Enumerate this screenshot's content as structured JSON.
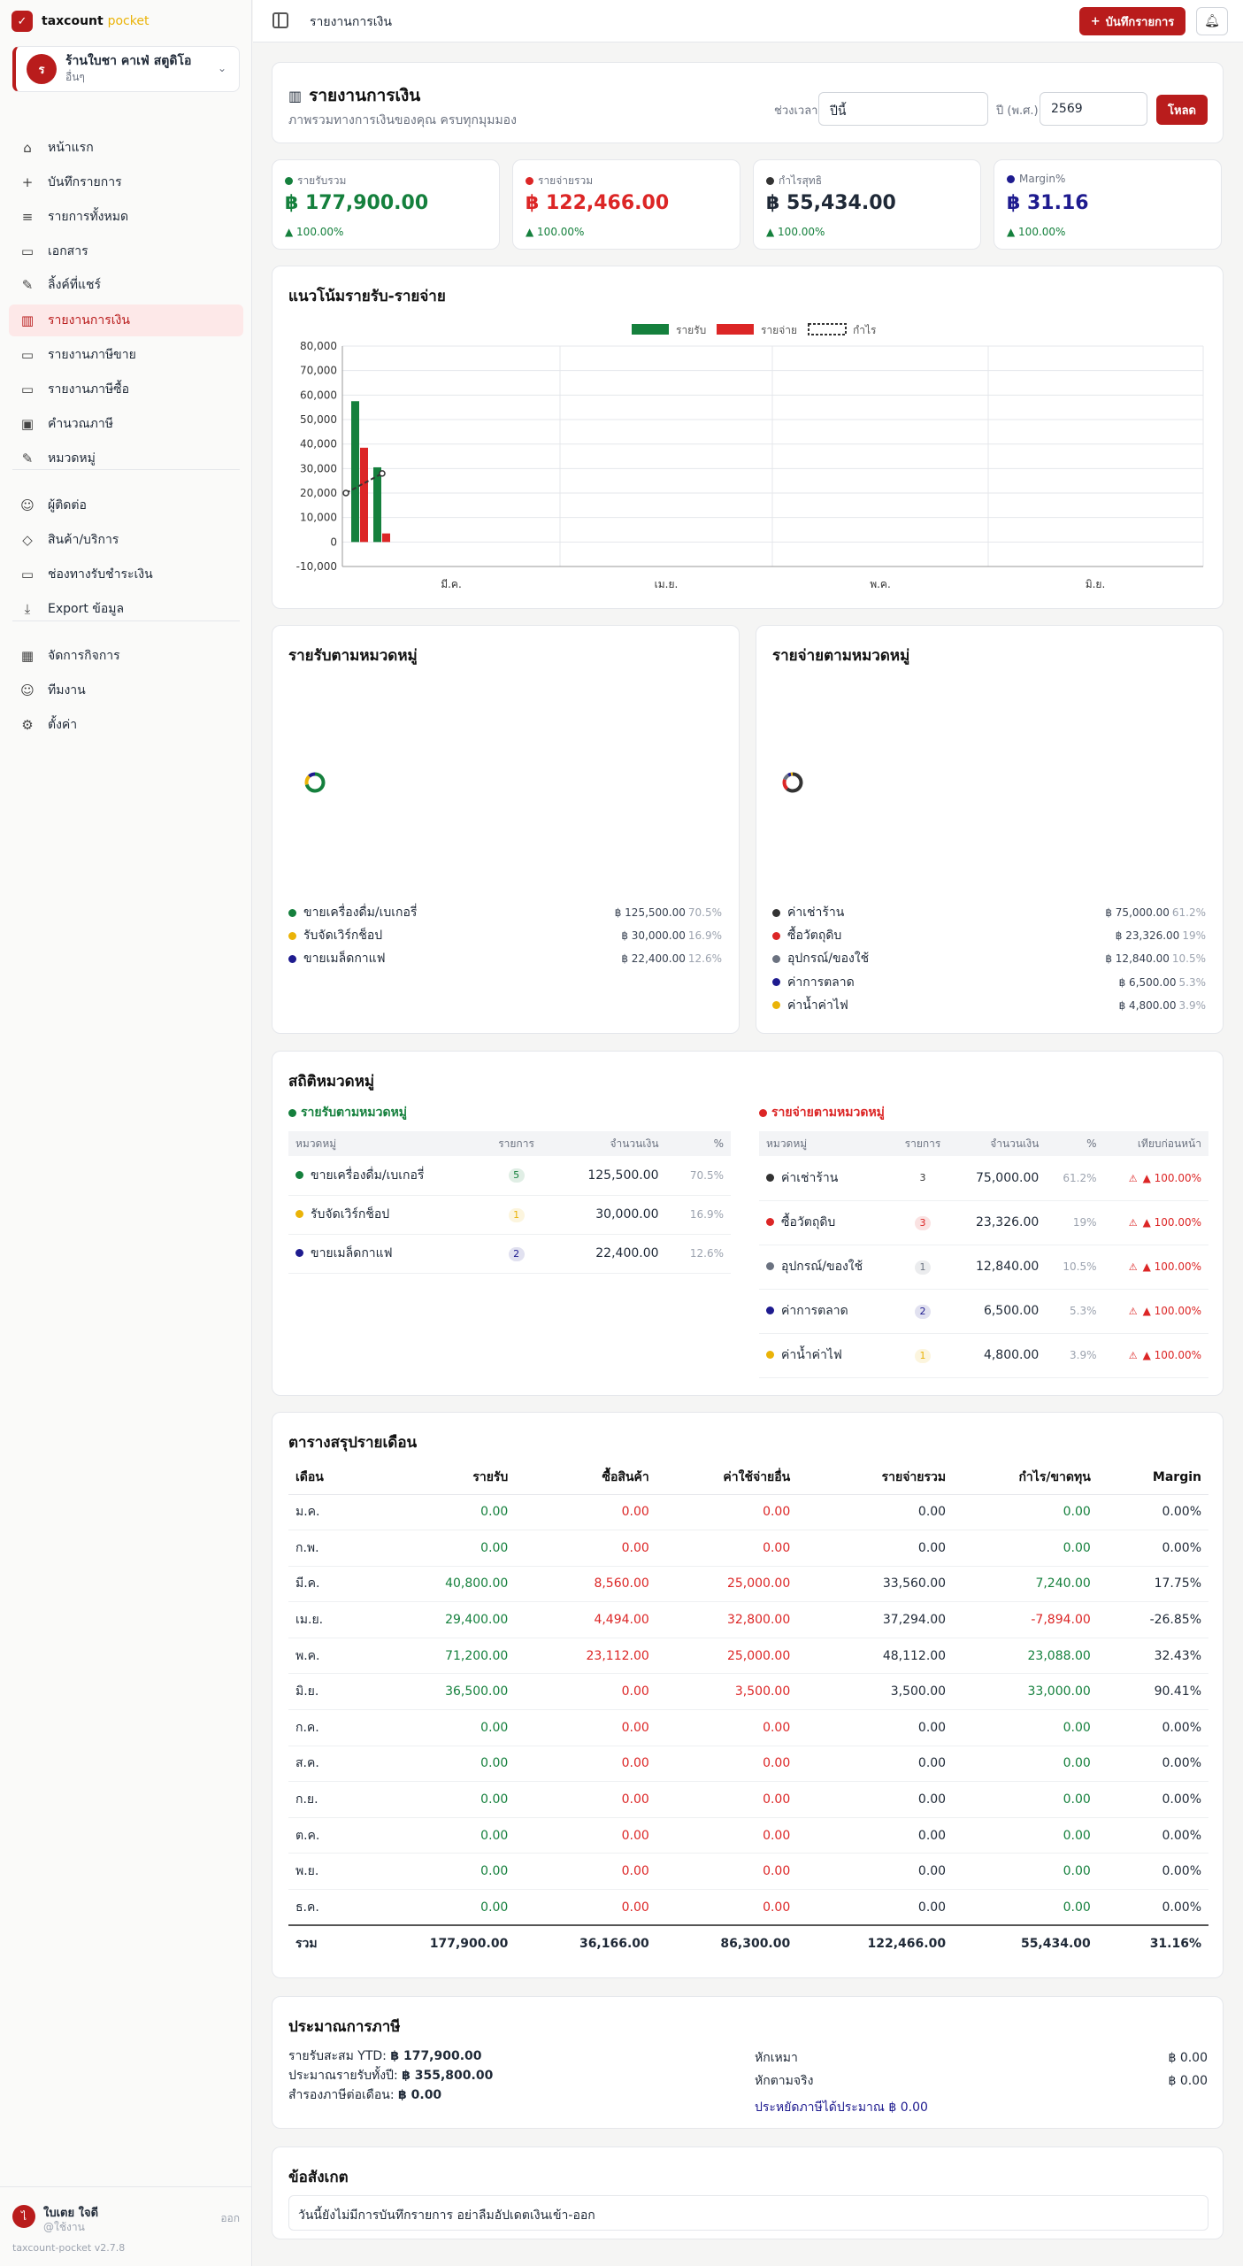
{
  "brand": {
    "name": "taxcount",
    "suffix": "pocket"
  },
  "workspace": {
    "initial": "ร",
    "name": "ร้านใบชา คาเฟ่ สตูดิโอ",
    "type": "อื่นๆ"
  },
  "nav": [
    {
      "label": "หน้าแรก",
      "icon": "home-icon",
      "glyph": "⌂"
    },
    {
      "label": "บันทึกรายการ",
      "icon": "plus-icon",
      "glyph": "+"
    },
    {
      "label": "รายการทั้งหมด",
      "icon": "list-icon",
      "glyph": "≡"
    },
    {
      "label": "เอกสาร",
      "icon": "document-icon",
      "glyph": "▭"
    },
    {
      "label": "ลิ้งค์ที่แชร์",
      "icon": "pencil-icon",
      "glyph": "✎"
    },
    {
      "label": "รายงานการเงิน",
      "icon": "bar-chart-icon",
      "glyph": "▥"
    },
    {
      "label": "รายงานภาษีขาย",
      "icon": "document-icon",
      "glyph": "▭"
    },
    {
      "label": "รายงานภาษีซื้อ",
      "icon": "document-icon",
      "glyph": "▭"
    },
    {
      "label": "คำนวณภาษี",
      "icon": "calculator-icon",
      "glyph": "▣"
    },
    {
      "label": "หมวดหมู่",
      "icon": "tag-icon",
      "glyph": "✎"
    },
    {
      "label": "ผู้ติดต่อ",
      "icon": "user-icon",
      "glyph": "☺"
    },
    {
      "label": "สินค้า/บริการ",
      "icon": "package-icon",
      "glyph": "◇"
    },
    {
      "label": "ช่องทางรับชำระเงิน",
      "icon": "credit-card-icon",
      "glyph": "▭"
    },
    {
      "label": "Export ข้อมูล",
      "icon": "download-icon",
      "glyph": "⤓"
    },
    {
      "label": "จัดการกิจการ",
      "icon": "building-icon",
      "glyph": "▦"
    },
    {
      "label": "ทีมงาน",
      "icon": "team-icon",
      "glyph": "☺"
    },
    {
      "label": "ตั้งค่า",
      "icon": "gear-icon",
      "glyph": "⚙"
    }
  ],
  "user": {
    "initial": "ไ",
    "name": "ใบเตย ใจดี",
    "role": "@ใช้งาน",
    "logout": "ออก",
    "version": "taxcount-pocket v2.7.8"
  },
  "topbar": {
    "title": "รายงานการเงิน",
    "add_label": "บันทึกรายการ"
  },
  "header": {
    "title": "รายงานการเงิน",
    "subtitle": "ภาพรวมทางการเงินของคุณ ครบทุกมุมมอง",
    "period_label": "ช่วงเวลา",
    "period_value": "ปีนี้",
    "year_label": "ปี (พ.ศ.)",
    "year_value": "2569",
    "load_label": "โหลด"
  },
  "kpis": [
    {
      "label": "รายรับรวม",
      "value": "฿ 177,900.00",
      "change": "▲ 100.00%",
      "color": "#15803d",
      "dot": "#15803d"
    },
    {
      "label": "รายจ่ายรวม",
      "value": "฿ 122,466.00",
      "change": "▲ 100.00%",
      "color": "#dc2626",
      "dot": "#dc2626"
    },
    {
      "label": "กำไรสุทธิ",
      "value": "฿ 55,434.00",
      "change": "▲ 100.00%",
      "color": "#1f2937",
      "dot": "#333"
    },
    {
      "label": "Margin%",
      "value": "฿ 31.16",
      "change": "▲ 100.00%",
      "color": "#1e1b8f",
      "dot": "#1e1b8f"
    }
  ],
  "chart_data": {
    "type": "bar",
    "title": "แนวโน้มรายรับ-รายจ่าย",
    "legend": [
      "รายรับ",
      "รายจ่าย",
      "กำไร"
    ],
    "x_labels": [
      "มี.ค.",
      "เม.ย.",
      "พ.ค.",
      "มิ.ย."
    ],
    "ylim": [
      -10000,
      80000
    ],
    "yticks": [
      "80,000",
      "70,000",
      "60,000",
      "50,000",
      "40,000",
      "30,000",
      "20,000",
      "10,000",
      "0",
      "-10,000"
    ],
    "series": [
      {
        "name": "รายรับ",
        "color": "#15803d",
        "values": [
          57500,
          30500
        ]
      },
      {
        "name": "รายจ่าย",
        "color": "#dc2626",
        "values": [
          38500,
          3500
        ]
      }
    ],
    "profit_points": [
      20000,
      28000
    ]
  },
  "income_cat": {
    "title": "รายรับตามหมวดหมู่",
    "items": [
      {
        "name": "ขายเครื่องดื่ม/เบเกอรี่",
        "amount": "฿ 125,500.00",
        "pct": "70.5%",
        "color": "#15803d"
      },
      {
        "name": "รับจัดเวิร์กช็อป",
        "amount": "฿ 30,000.00",
        "pct": "16.9%",
        "color": "#eab308"
      },
      {
        "name": "ขายเมล็ดกาแฟ",
        "amount": "฿ 22,400.00",
        "pct": "12.6%",
        "color": "#1e1b8f"
      }
    ]
  },
  "expense_cat": {
    "title": "รายจ่ายตามหมวดหมู่",
    "items": [
      {
        "name": "ค่าเช่าร้าน",
        "amount": "฿ 75,000.00",
        "pct": "61.2%",
        "color": "#333"
      },
      {
        "name": "ซื้อวัตถุดิบ",
        "amount": "฿ 23,326.00",
        "pct": "19%",
        "color": "#dc2626"
      },
      {
        "name": "อุปกรณ์/ของใช้",
        "amount": "฿ 12,840.00",
        "pct": "10.5%",
        "color": "#6b7280"
      },
      {
        "name": "ค่าการตลาด",
        "amount": "฿ 6,500.00",
        "pct": "5.3%",
        "color": "#1e1b8f"
      },
      {
        "name": "ค่าน้ำค่าไฟ",
        "amount": "฿ 4,800.00",
        "pct": "3.9%",
        "color": "#eab308"
      }
    ]
  },
  "stats": {
    "title": "สถิติหมวดหมู่",
    "income_title": "รายรับตามหมวดหมู่",
    "expense_title": "รายจ่ายตามหมวดหมู่",
    "income_cols": [
      "หมวดหมู่",
      "รายการ",
      "จำนวนเงิน",
      "%"
    ],
    "expense_cols": [
      "หมวดหมู่",
      "รายการ",
      "จำนวนเงิน",
      "%",
      "เทียบก่อนหน้า"
    ],
    "income_rows": [
      {
        "name": "ขายเครื่องดื่ม/เบเกอรี่",
        "count": "5",
        "amount": "125,500.00",
        "pct": "70.5%",
        "color": "#15803d"
      },
      {
        "name": "รับจัดเวิร์กช็อป",
        "count": "1",
        "amount": "30,000.00",
        "pct": "16.9%",
        "color": "#eab308"
      },
      {
        "name": "ขายเมล็ดกาแฟ",
        "count": "2",
        "amount": "22,400.00",
        "pct": "12.6%",
        "color": "#1e1b8f"
      }
    ],
    "expense_rows": [
      {
        "name": "ค่าเช่าร้าน",
        "count": "3",
        "amount": "75,000.00",
        "pct": "61.2%",
        "change": "▲ 100.00%",
        "color": "#333"
      },
      {
        "name": "ซื้อวัตถุดิบ",
        "count": "3",
        "amount": "23,326.00",
        "pct": "19%",
        "change": "▲ 100.00%",
        "color": "#dc2626"
      },
      {
        "name": "อุปกรณ์/ของใช้",
        "count": "1",
        "amount": "12,840.00",
        "pct": "10.5%",
        "change": "▲ 100.00%",
        "color": "#6b7280"
      },
      {
        "name": "ค่าการตลาด",
        "count": "2",
        "amount": "6,500.00",
        "pct": "5.3%",
        "change": "▲ 100.00%",
        "color": "#1e1b8f"
      },
      {
        "name": "ค่าน้ำค่าไฟ",
        "count": "1",
        "amount": "4,800.00",
        "pct": "3.9%",
        "change": "▲ 100.00%",
        "color": "#eab308"
      }
    ]
  },
  "monthly": {
    "title": "ตารางสรุปรายเดือน",
    "cols": [
      "เดือน",
      "รายรับ",
      "ซื้อสินค้า",
      "ค่าใช้จ่ายอื่น",
      "รายจ่ายรวม",
      "กำไร/ขาดทุน",
      "Margin"
    ],
    "rows": [
      [
        "ม.ค.",
        "0.00",
        "0.00",
        "0.00",
        "0.00",
        "0.00",
        "0.00%"
      ],
      [
        "ก.พ.",
        "0.00",
        "0.00",
        "0.00",
        "0.00",
        "0.00",
        "0.00%"
      ],
      [
        "มี.ค.",
        "40,800.00",
        "8,560.00",
        "25,000.00",
        "33,560.00",
        "7,240.00",
        "17.75%"
      ],
      [
        "เม.ย.",
        "29,400.00",
        "4,494.00",
        "32,800.00",
        "37,294.00",
        "-7,894.00",
        "-26.85%"
      ],
      [
        "พ.ค.",
        "71,200.00",
        "23,112.00",
        "25,000.00",
        "48,112.00",
        "23,088.00",
        "32.43%"
      ],
      [
        "มิ.ย.",
        "36,500.00",
        "0.00",
        "3,500.00",
        "3,500.00",
        "33,000.00",
        "90.41%"
      ],
      [
        "ก.ค.",
        "0.00",
        "0.00",
        "0.00",
        "0.00",
        "0.00",
        "0.00%"
      ],
      [
        "ส.ค.",
        "0.00",
        "0.00",
        "0.00",
        "0.00",
        "0.00",
        "0.00%"
      ],
      [
        "ก.ย.",
        "0.00",
        "0.00",
        "0.00",
        "0.00",
        "0.00",
        "0.00%"
      ],
      [
        "ต.ค.",
        "0.00",
        "0.00",
        "0.00",
        "0.00",
        "0.00",
        "0.00%"
      ],
      [
        "พ.ย.",
        "0.00",
        "0.00",
        "0.00",
        "0.00",
        "0.00",
        "0.00%"
      ],
      [
        "ธ.ค.",
        "0.00",
        "0.00",
        "0.00",
        "0.00",
        "0.00",
        "0.00%"
      ]
    ],
    "total": [
      "รวม",
      "177,900.00",
      "36,166.00",
      "86,300.00",
      "122,466.00",
      "55,434.00",
      "31.16%"
    ]
  },
  "tax": {
    "title": "ประมาณการภาษี",
    "ytd_label": "รายรับสะสม YTD:",
    "ytd_value": "฿ 177,900.00",
    "annual_label": "ประมาณรายรับทั้งปี:",
    "annual_value": "฿ 355,800.00",
    "reserve_label": "สำรองภาษีต่อเดือน:",
    "reserve_value": "฿ 0.00",
    "flat_label": "หักเหมา",
    "flat_value": "฿ 0.00",
    "actual_label": "หักตามจริง",
    "actual_value": "฿ 0.00",
    "saving": "ประหยัดภาษีได้ประมาณ ฿ 0.00"
  },
  "notes": {
    "title": "ข้อสังเกต",
    "text": "วันนี้ยังไม่มีการบันทึกรายการ อย่าลืมอัปเดตเงินเข้า-ออก"
  }
}
